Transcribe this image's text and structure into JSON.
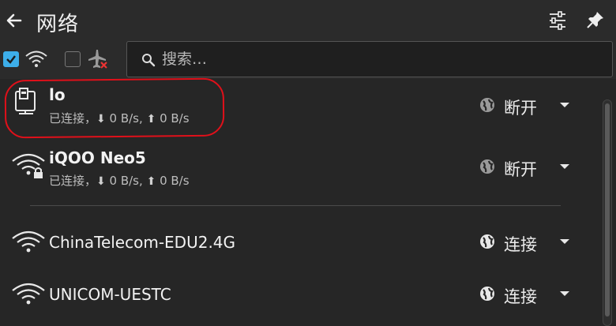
{
  "header": {
    "title": "网络"
  },
  "search": {
    "placeholder": "搜索…"
  },
  "toolbar": {
    "wifi_enabled": true,
    "airplane_mode": false
  },
  "connections": [
    {
      "name": "lo",
      "status_prefix": "已连接，",
      "down": "0 B/s,",
      "up": "0 B/s",
      "action": "断开",
      "icon": "wired-network-icon"
    },
    {
      "name": "iQOO Neo5",
      "status_prefix": "已连接，",
      "down": "0 B/s,",
      "up": "0 B/s",
      "action": "断开",
      "icon": "wifi-locked-icon"
    },
    {
      "name": "ChinaTelecom-EDU2.4G",
      "action": "连接",
      "icon": "wifi-icon"
    },
    {
      "name": "UNICOM-UESTC",
      "action": "连接",
      "icon": "wifi-icon"
    }
  ],
  "colors": {
    "background": "#262626",
    "accent": "#3daee9",
    "highlight": "#e0101a"
  }
}
